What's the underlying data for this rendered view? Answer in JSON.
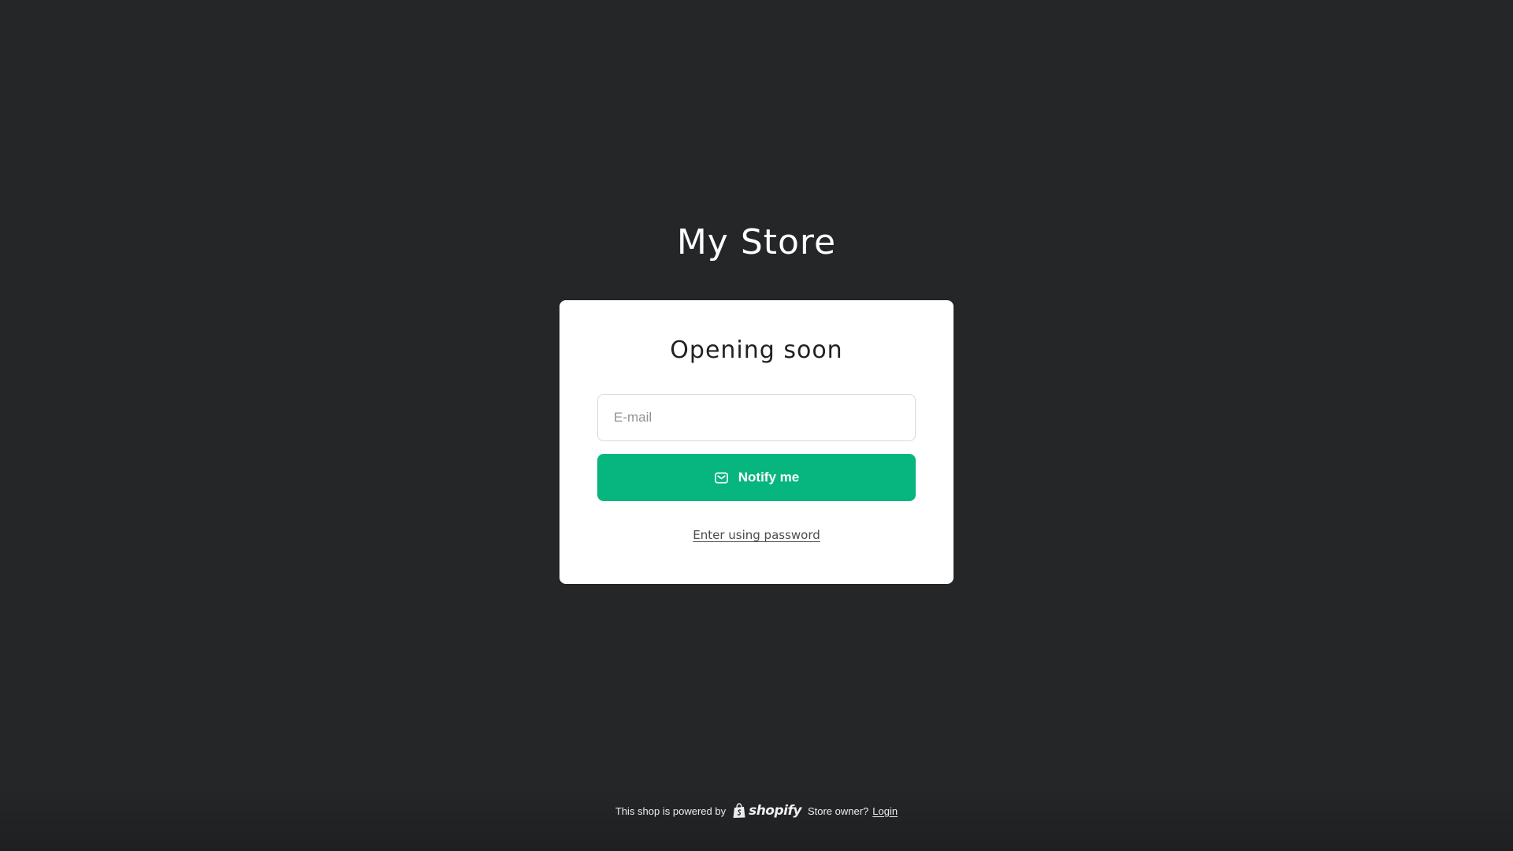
{
  "store": {
    "title": "My Store"
  },
  "card": {
    "heading": "Opening soon",
    "email_placeholder": "E-mail",
    "email_value": "",
    "notify_label": "Notify me",
    "password_link": "Enter using password"
  },
  "footer": {
    "powered_by": "This shop is powered by",
    "brand": "shopify",
    "owner_text": "Store owner?",
    "login_label": "Login"
  },
  "icons": {
    "notify": "mail-icon",
    "brand": "shopify-bag-icon"
  },
  "colors": {
    "background": "#252628",
    "card": "#ffffff",
    "accent": "#07b67e",
    "text_dark": "#1f2124"
  }
}
